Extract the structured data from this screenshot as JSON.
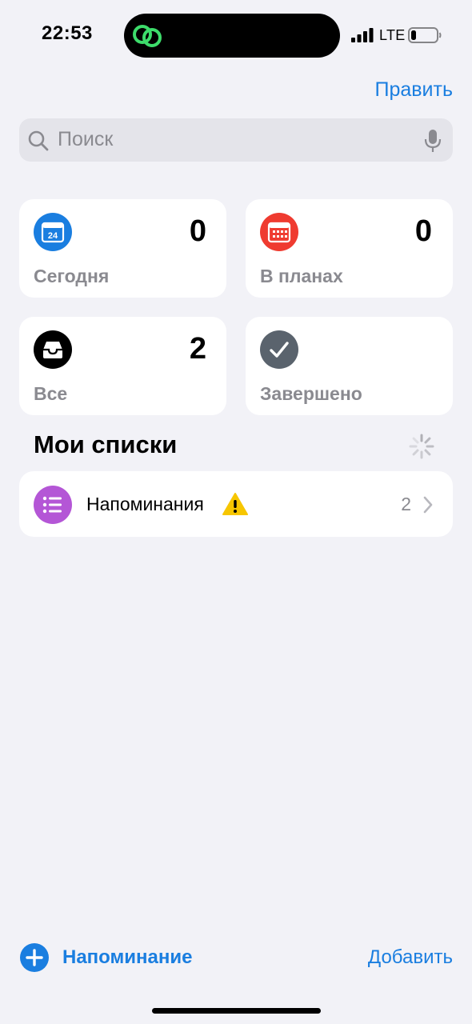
{
  "status_bar": {
    "time": "22:53",
    "network": "LTE",
    "battery_level": 0.2
  },
  "header": {
    "edit_label": "Править"
  },
  "search": {
    "placeholder": "Поиск"
  },
  "smart_lists": [
    {
      "label": "Сегодня",
      "count": "0",
      "icon": "calendar-today-icon",
      "icon_text": "24",
      "color": "#1a7ee0"
    },
    {
      "label": "В планах",
      "count": "0",
      "icon": "calendar-scheduled-icon",
      "color": "#ef3b30"
    },
    {
      "label": "Все",
      "count": "2",
      "icon": "tray-icon",
      "color": "#000000"
    },
    {
      "label": "Завершено",
      "count": "",
      "icon": "checkmark-icon",
      "color": "#5a636d"
    }
  ],
  "my_lists": {
    "title": "Мои списки",
    "items": [
      {
        "name": "Напоминания",
        "count": "2",
        "icon": "list-bullet-icon",
        "color": "#b456d6",
        "warning": true
      }
    ]
  },
  "toolbar": {
    "new_reminder_label": "Напоминание",
    "add_list_label": "Добавить"
  },
  "colors": {
    "accent": "#1a7ee0",
    "background": "#f2f2f7",
    "secondary_text": "#8a8a90"
  }
}
